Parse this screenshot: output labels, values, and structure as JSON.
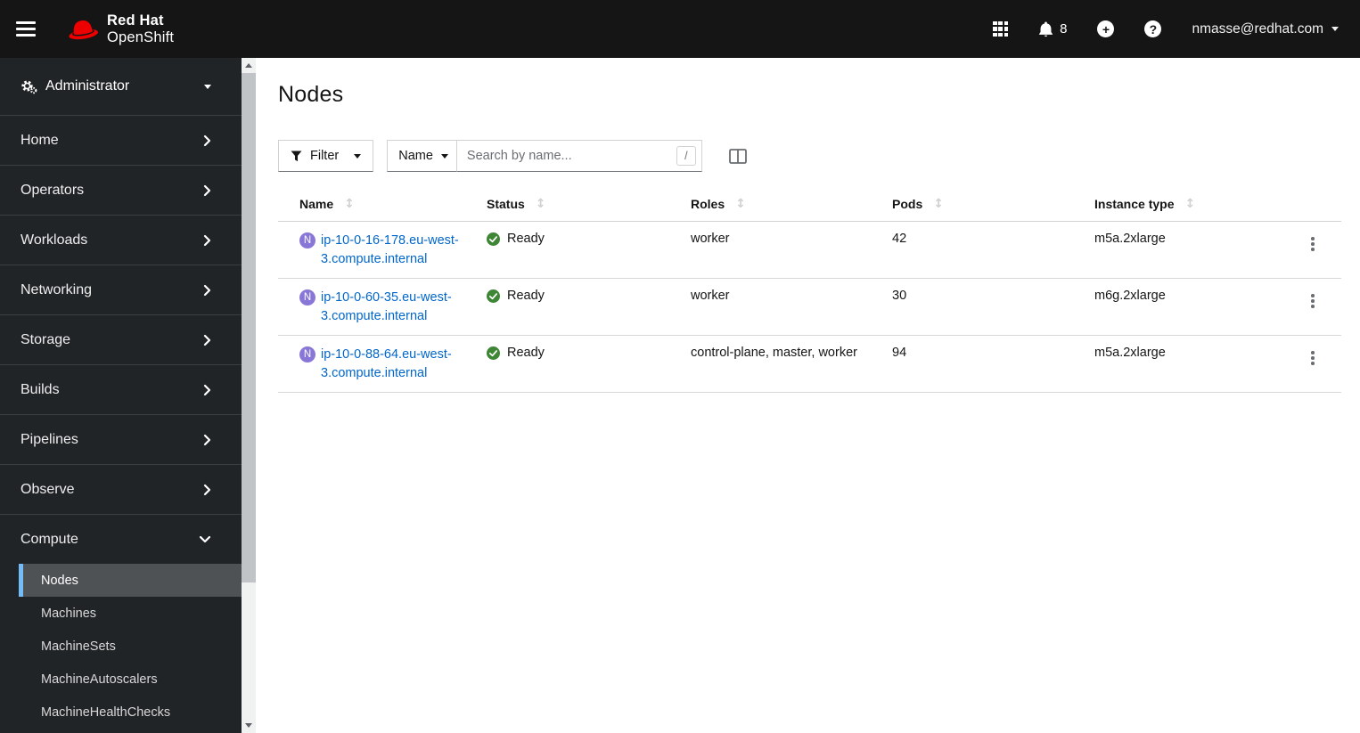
{
  "masthead": {
    "brand_line1": "Red Hat",
    "brand_line2": "OpenShift",
    "notification_count": "8",
    "user_email": "nmasse@redhat.com"
  },
  "perspective": {
    "label": "Administrator"
  },
  "sidebar": {
    "items": [
      {
        "label": "Home"
      },
      {
        "label": "Operators"
      },
      {
        "label": "Workloads"
      },
      {
        "label": "Networking"
      },
      {
        "label": "Storage"
      },
      {
        "label": "Builds"
      },
      {
        "label": "Pipelines"
      },
      {
        "label": "Observe"
      },
      {
        "label": "Compute",
        "expanded": true
      }
    ],
    "compute_children": [
      {
        "label": "Nodes",
        "selected": true
      },
      {
        "label": "Machines"
      },
      {
        "label": "MachineSets"
      },
      {
        "label": "MachineAutoscalers"
      },
      {
        "label": "MachineHealthChecks"
      }
    ]
  },
  "page": {
    "title": "Nodes"
  },
  "toolbar": {
    "filter_label": "Filter",
    "search_attribute": "Name",
    "search_placeholder": "Search by name...",
    "search_value": "",
    "search_shortcut": "/"
  },
  "table": {
    "columns": [
      "Name",
      "Status",
      "Roles",
      "Pods",
      "Instance type"
    ],
    "rows": [
      {
        "badge": "N",
        "name": "ip-10-0-16-178.eu-west-3.compute.internal",
        "status": "Ready",
        "roles": "worker",
        "pods": "42",
        "instance_type": "m5a.2xlarge"
      },
      {
        "badge": "N",
        "name": "ip-10-0-60-35.eu-west-3.compute.internal",
        "status": "Ready",
        "roles": "worker",
        "pods": "30",
        "instance_type": "m6g.2xlarge"
      },
      {
        "badge": "N",
        "name": "ip-10-0-88-64.eu-west-3.compute.internal",
        "status": "Ready",
        "roles": "control-plane, master, worker",
        "pods": "94",
        "instance_type": "m5a.2xlarge"
      }
    ]
  },
  "icons": {
    "masthead": [
      "hamburger-icon",
      "redhat-fedora-icon",
      "app-launcher-icon",
      "bell-icon",
      "plus-circle-icon",
      "question-circle-icon",
      "caret-down-icon"
    ],
    "sidebar": [
      "cogs-icon",
      "chevron-right-icon",
      "chevron-down-icon"
    ],
    "toolbar": [
      "filter-funnel-icon",
      "columns-icon"
    ],
    "table": [
      "sort-icon",
      "node-badge",
      "ready-check-icon",
      "kebab-icon"
    ]
  },
  "colors": {
    "masthead_bg": "#151515",
    "sidebar_bg": "#212427",
    "nav_separator": "#3c3f42",
    "nav_selected_bg": "#4f5255",
    "nav_selected_accent": "#73bcf7",
    "link_blue": "#0066cc",
    "status_ready_green": "#3e8635",
    "node_badge_purple": "#8877d6",
    "brand_red": "#ee0000"
  }
}
